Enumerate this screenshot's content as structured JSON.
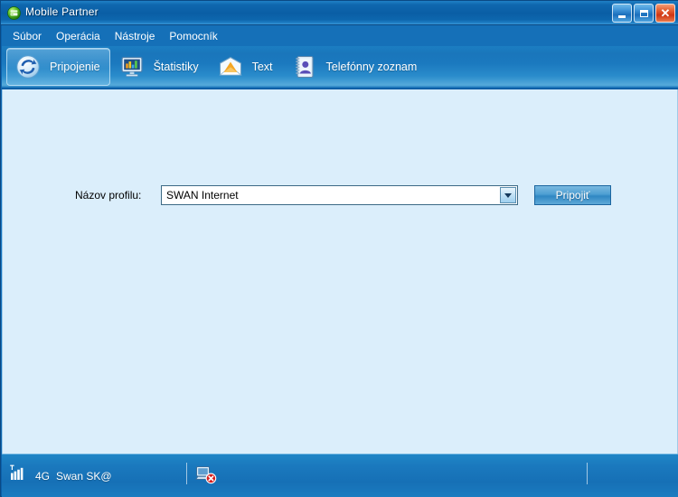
{
  "window": {
    "title": "Mobile Partner",
    "icon": "app-globe-icon",
    "controls": {
      "minimize": "Minimize",
      "maximize": "Maximize",
      "close": "Close"
    }
  },
  "menubar": {
    "items": [
      {
        "label": "Súbor",
        "name": "menu-subor"
      },
      {
        "label": "Operácia",
        "name": "menu-operacia"
      },
      {
        "label": "Nástroje",
        "name": "menu-nastroje"
      },
      {
        "label": "Pomocník",
        "name": "menu-pomocnik"
      }
    ]
  },
  "toolbar": {
    "items": [
      {
        "label": "Pripojenie",
        "icon": "sync-arrows-icon",
        "selected": true
      },
      {
        "label": "Štatistiky",
        "icon": "monitor-chart-icon",
        "selected": false
      },
      {
        "label": "Text",
        "icon": "envelope-icon",
        "selected": false
      },
      {
        "label": "Telefónny zoznam",
        "icon": "address-book-icon",
        "selected": false
      }
    ]
  },
  "main": {
    "profile_label": "Názov profilu:",
    "profile_value": "SWAN Internet",
    "profile_placeholder": "SWAN Internet",
    "connect_button": "Pripojiť"
  },
  "statusbar": {
    "signal_icon": "signal-bars-icon",
    "network_type": "4G",
    "operator": "Swan SK@",
    "disconnected_icon": "computer-disconnected-icon"
  },
  "colors": {
    "titlebar_blue": "#0a5ea5",
    "menubar_blue": "#1570b8",
    "content_bg": "#dbeefb",
    "accent": "#2f87c3",
    "close_red": "#cf3513",
    "error_red": "#d61f1f"
  }
}
